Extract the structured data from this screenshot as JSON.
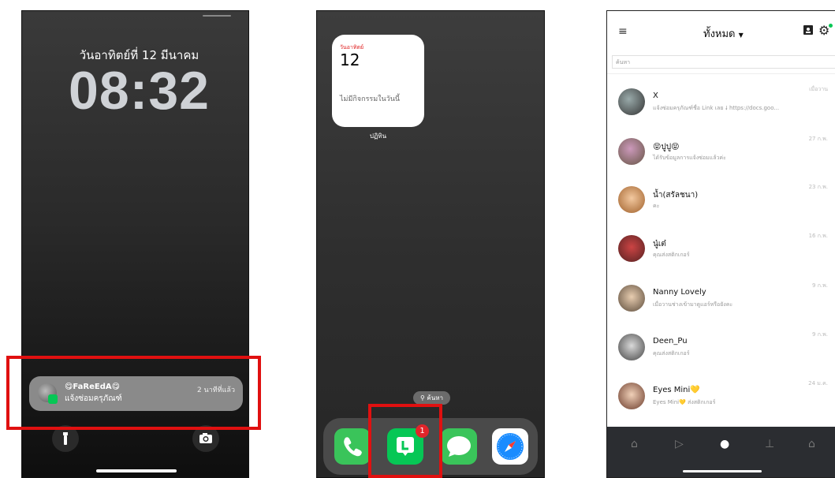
{
  "lock_screen": {
    "date": "วันอาทิตย์ที่ 12 มีนาคม",
    "time": "08:32",
    "notification": {
      "sender": "😋FaReEdA😋",
      "message": "แจ้งซ่อมครุภัณฑ์",
      "time_ago": "2 นาทีที่แล้ว"
    },
    "flashlight_icon": "flashlight-icon",
    "camera_icon": "camera-icon"
  },
  "home_screen": {
    "widget": {
      "day_label": "วันอาทิตย์",
      "day_number": "12",
      "message": "ไม่มีกิจกรรมในวันนี้",
      "caption": "ปฏิทิน"
    },
    "search_label": "ค้นหา",
    "dock_apps": [
      "phone",
      "line",
      "messages",
      "safari"
    ],
    "line_badge": "1"
  },
  "line_app": {
    "header_title": "ทั้งหมด",
    "search_placeholder": "ค้นหา",
    "chats": [
      {
        "name": "X",
        "preview": "แจ้งซ่อมครุภัณฑ์ชื่อ Link เลย 🠗 https://docs.goo...",
        "time": "เมื่อวาน"
      },
      {
        "name": "😝ปูปู😝",
        "preview": "ได้รับข้อมูลการแจ้งซ่อมแล้วค่ะ",
        "time": "27 ก.พ."
      },
      {
        "name": "น้ำ(สรัลชนา)",
        "preview": "คะ",
        "time": "23 ก.พ."
      },
      {
        "name": "นู๋เต๋",
        "preview": "คุณส่งสติกเกอร์",
        "time": "16 ก.พ."
      },
      {
        "name": "Nanny Lovely",
        "preview": "เมื่อวานช่างเข้ามาดูแอร์หรือยังคะ",
        "time": "9 ก.พ."
      },
      {
        "name": "Deen_Pu",
        "preview": "คุณส่งสติกเกอร์",
        "time": "9 ก.พ."
      },
      {
        "name": "Eyes Mini💛",
        "preview": "Eyes Mini💛 ส่งสติกเกอร์",
        "time": "24 ม.ค."
      }
    ],
    "accent_color": "#06c755"
  }
}
